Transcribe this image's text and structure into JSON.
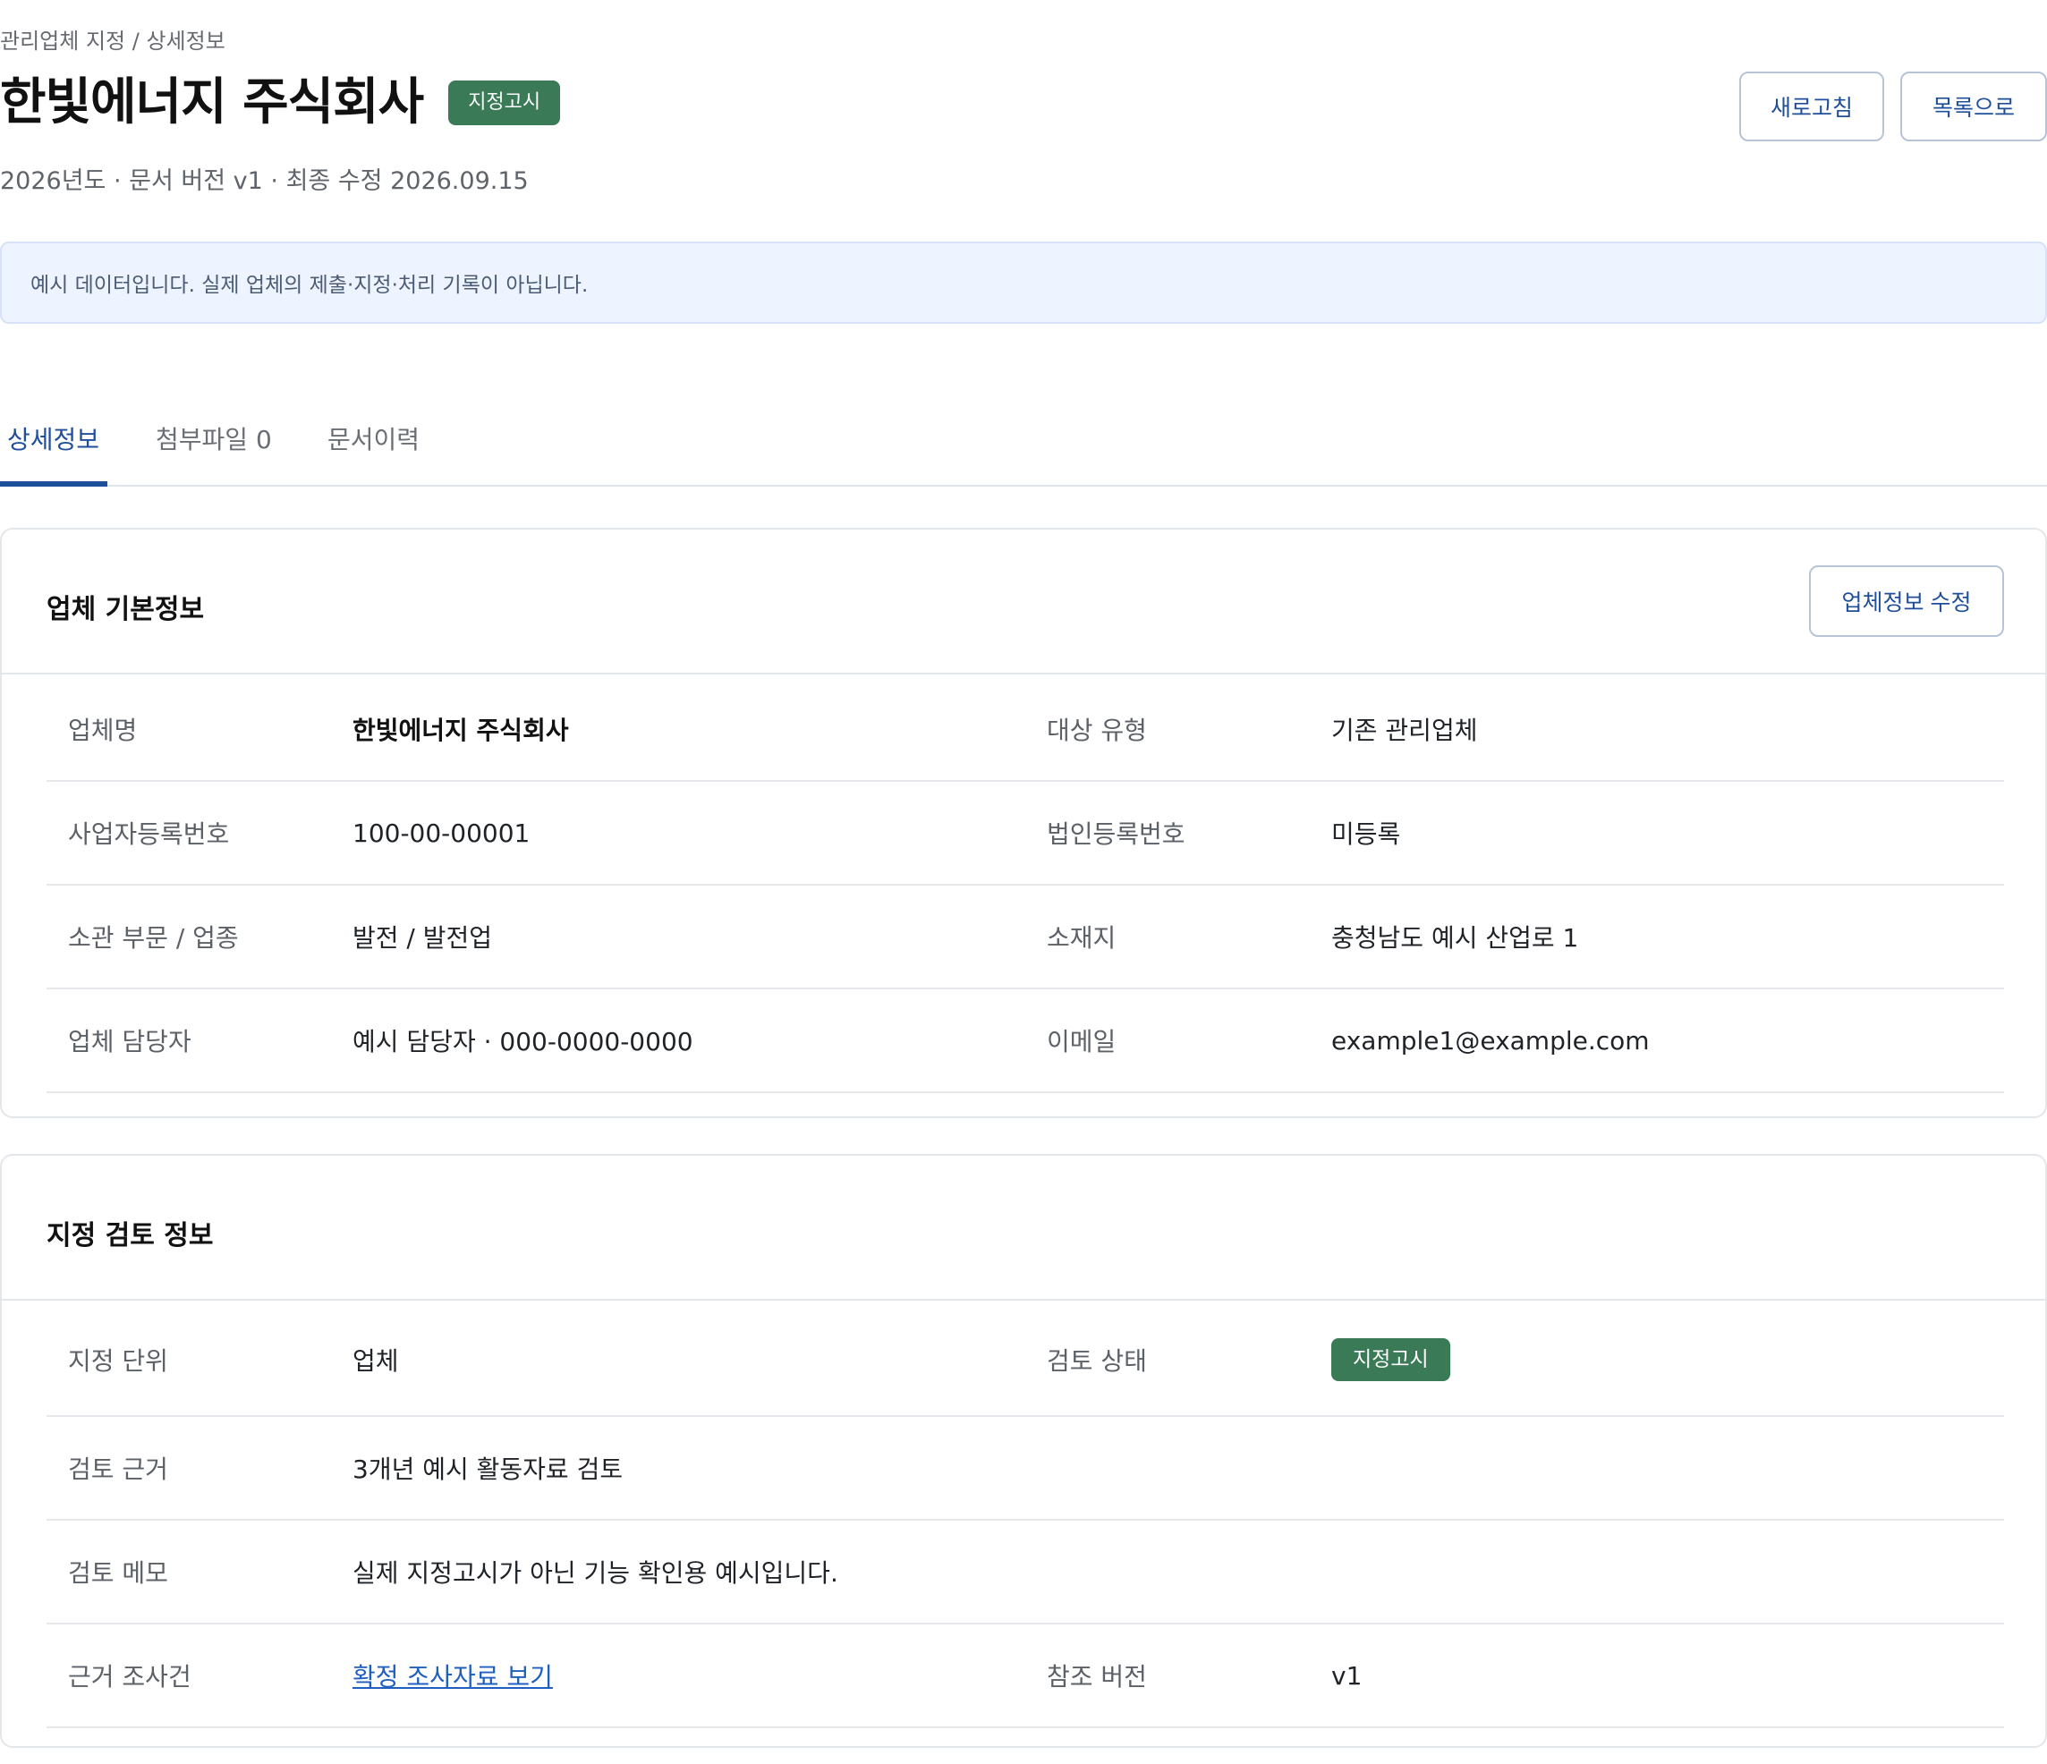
{
  "breadcrumb": "관리업체 지정 / 상세정보",
  "header": {
    "title": "한빛에너지 주식회사",
    "status_badge": "지정고시",
    "meta": "2026년도 · 문서 버전 v1 · 최종 수정 2026.09.15",
    "refresh_label": "새로고침",
    "list_label": "목록으로"
  },
  "notice": "예시 데이터입니다. 실제 업체의 제출·지정·처리 기록이 아닙니다.",
  "tabs": [
    {
      "label": "상세정보",
      "active": true
    },
    {
      "label": "첨부파일 0",
      "active": false
    },
    {
      "label": "문서이력",
      "active": false
    }
  ],
  "company_card": {
    "title": "업체 기본정보",
    "edit_label": "업체정보 수정",
    "rows": [
      {
        "label1": "업체명",
        "value1": "한빛에너지 주식회사",
        "label2": "대상 유형",
        "value2": "기존 관리업체"
      },
      {
        "label1": "사업자등록번호",
        "value1": "100-00-00001",
        "label2": "법인등록번호",
        "value2": "미등록"
      },
      {
        "label1": "소관 부문 / 업종",
        "value1": "발전 / 발전업",
        "label2": "소재지",
        "value2": "충청남도 예시 산업로 1"
      },
      {
        "label1": "업체 담당자",
        "value1": "예시 담당자 · 000-0000-0000",
        "label2": "이메일",
        "value2": "example1@example.com"
      }
    ]
  },
  "review_card": {
    "title": "지정 검토 정보",
    "rows": [
      {
        "label1": "지정 단위",
        "value1": "업체",
        "label2": "검토 상태",
        "value2": "지정고시"
      },
      {
        "label1": "검토 근거",
        "value1": "3개년 예시 활동자료 검토"
      },
      {
        "label1": "검토 메모",
        "value1": "실제 지정고시가 아닌 기능 확인용 예시입니다."
      },
      {
        "label1": "근거 조사건",
        "value1": "확정 조사자료 보기",
        "label2": "참조 버전",
        "value2": "v1"
      }
    ]
  },
  "colors": {
    "accent": "#1f4e9a",
    "status_green": "#3a7a57",
    "notice_bg": "#eef4ff",
    "link": "#1f5fbf"
  }
}
